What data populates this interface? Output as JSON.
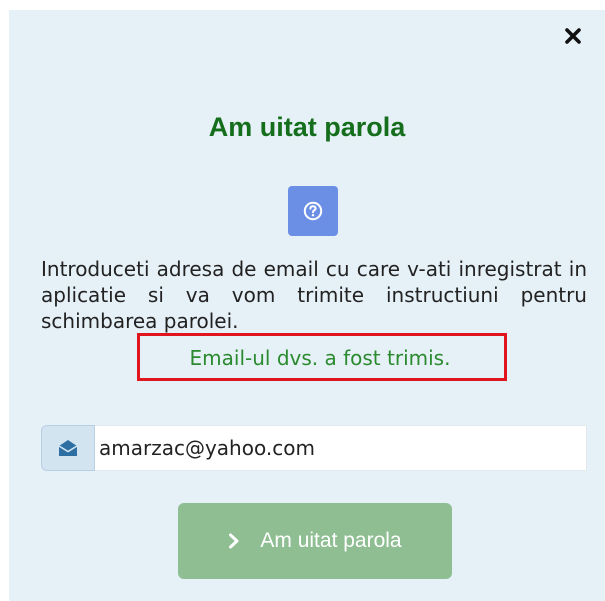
{
  "modal": {
    "title": "Am uitat parola",
    "close_icon": "close-icon",
    "help_icon": "question-circle-icon",
    "description": "Introduceti adresa de email cu care v-ati inregistrat in aplicatie si va vom trimite instructiuni pentru schimbarea parolei.",
    "success_message": "Email-ul dvs. a fost trimis.",
    "email_field": {
      "icon": "envelope-open-icon",
      "value": "amarzac@yahoo.com"
    },
    "submit": {
      "icon": "chevron-right-icon",
      "label": "Am uitat parola"
    }
  },
  "colors": {
    "title_green": "#156e1c",
    "success_green": "#2a8a2e",
    "highlight_red": "#e0161e",
    "help_blue": "#6b8fe5",
    "button_green": "#8fbe93",
    "modal_bg": "#e6f0f7"
  }
}
